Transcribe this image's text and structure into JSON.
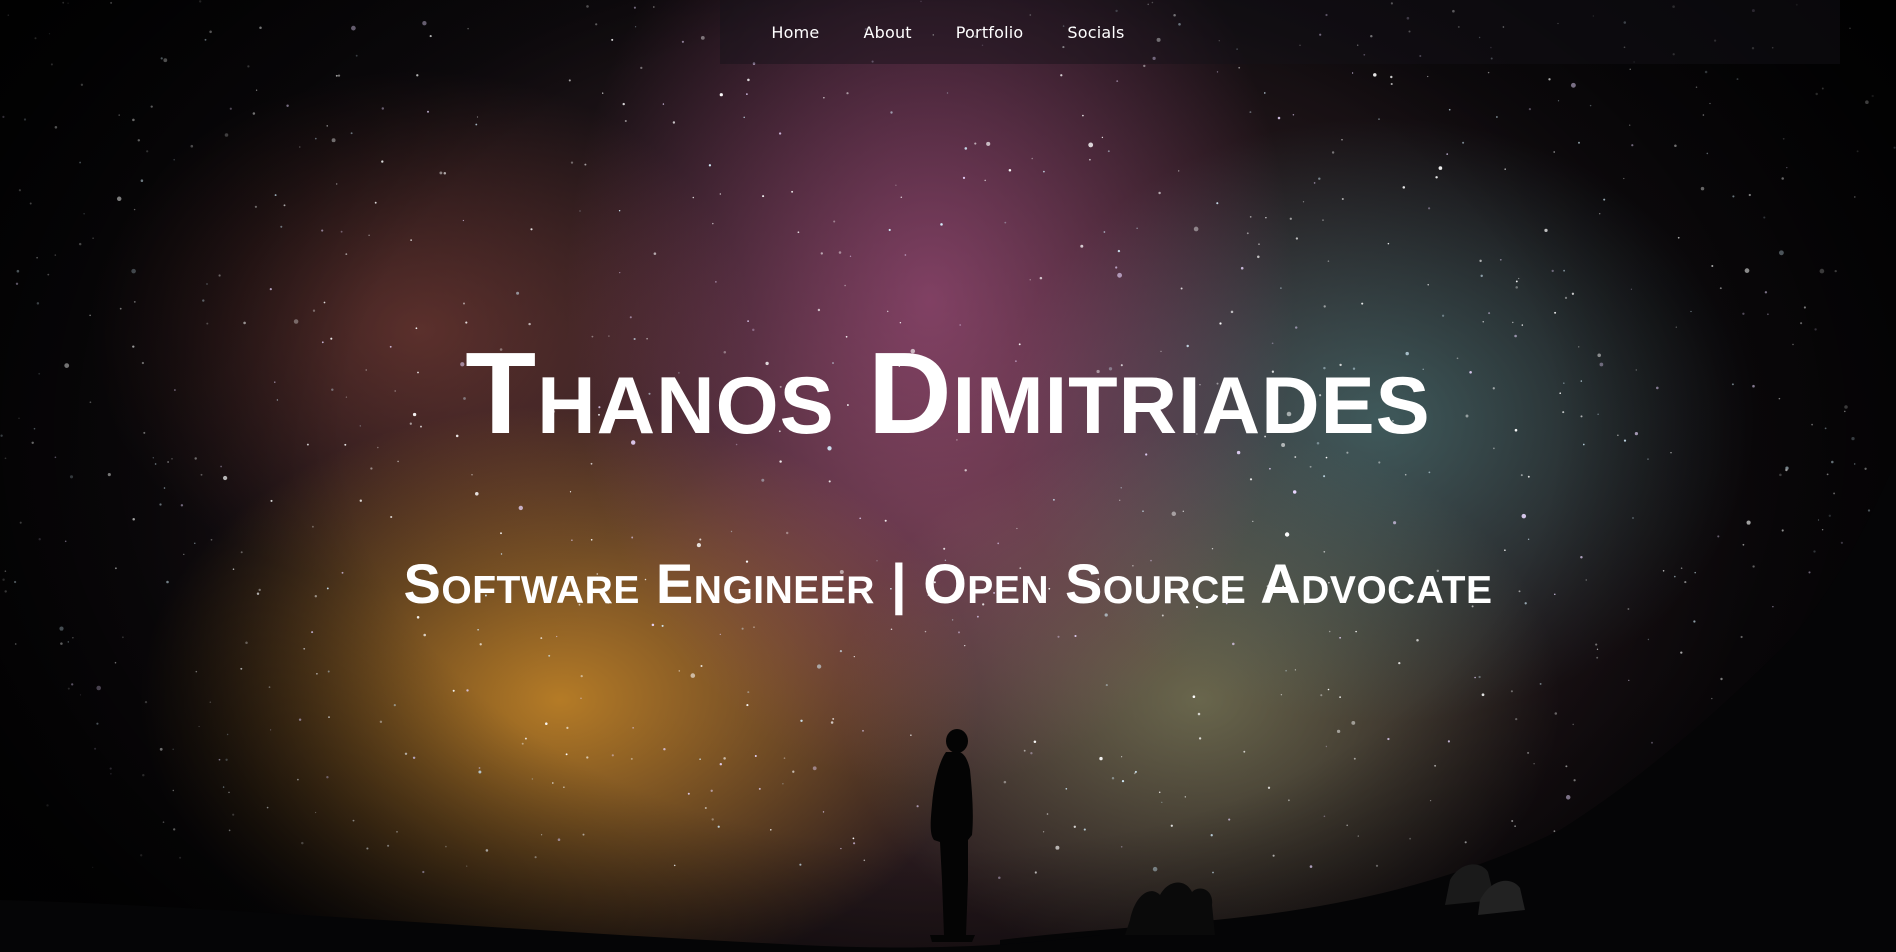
{
  "nav": {
    "items": [
      {
        "label": "Home"
      },
      {
        "label": "About"
      },
      {
        "label": "Portfolio"
      },
      {
        "label": "Socials"
      }
    ]
  },
  "hero": {
    "title": "Thanos Dimitriades",
    "subtitle": "Software Engineer | Open Source Advocate"
  },
  "colors": {
    "text": "#ffffff",
    "background": "#060608"
  }
}
